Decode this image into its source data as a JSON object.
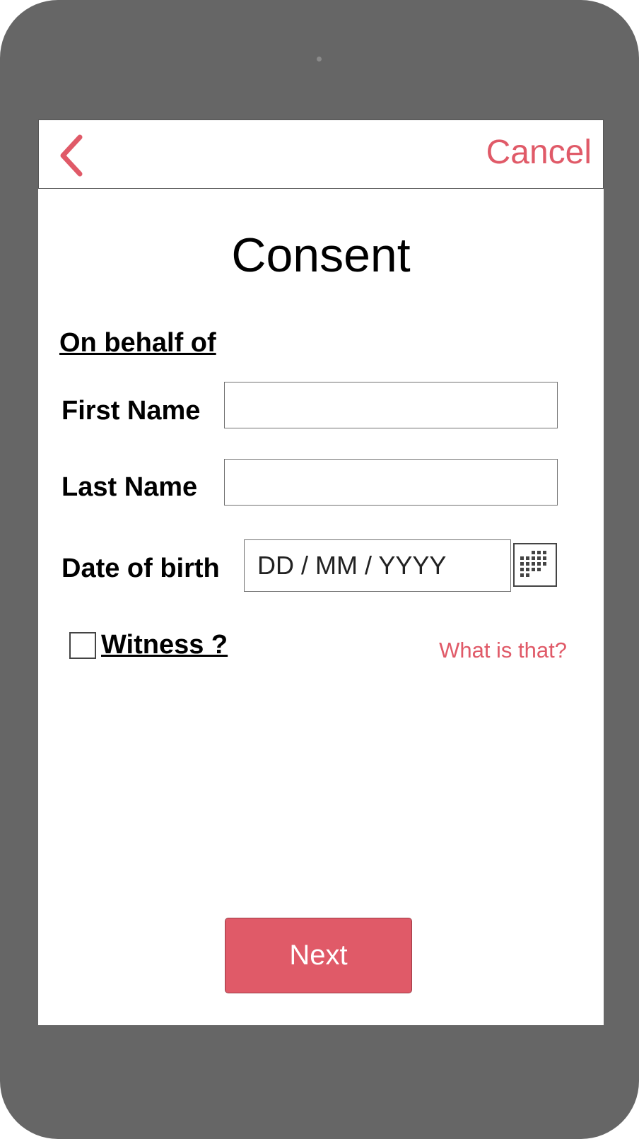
{
  "header": {
    "back_icon": "chevron-left-icon",
    "cancel_label": "Cancel"
  },
  "page": {
    "title": "Consent",
    "section_heading": "On behalf of"
  },
  "form": {
    "first_name": {
      "label": "First Name",
      "value": "",
      "placeholder": ""
    },
    "last_name": {
      "label": "Last Name",
      "value": "",
      "placeholder": ""
    },
    "date_of_birth": {
      "label": "Date of birth",
      "value": "",
      "placeholder": "DD / MM / YYYY",
      "picker_icon": "calendar-grid-icon"
    },
    "witness": {
      "label": "Witness ?",
      "checked": false
    },
    "help_link": "What is that?"
  },
  "actions": {
    "next_label": "Next"
  },
  "colors": {
    "accent": "#e05a68",
    "device_frame": "#666666",
    "screen": "#ffffff"
  }
}
